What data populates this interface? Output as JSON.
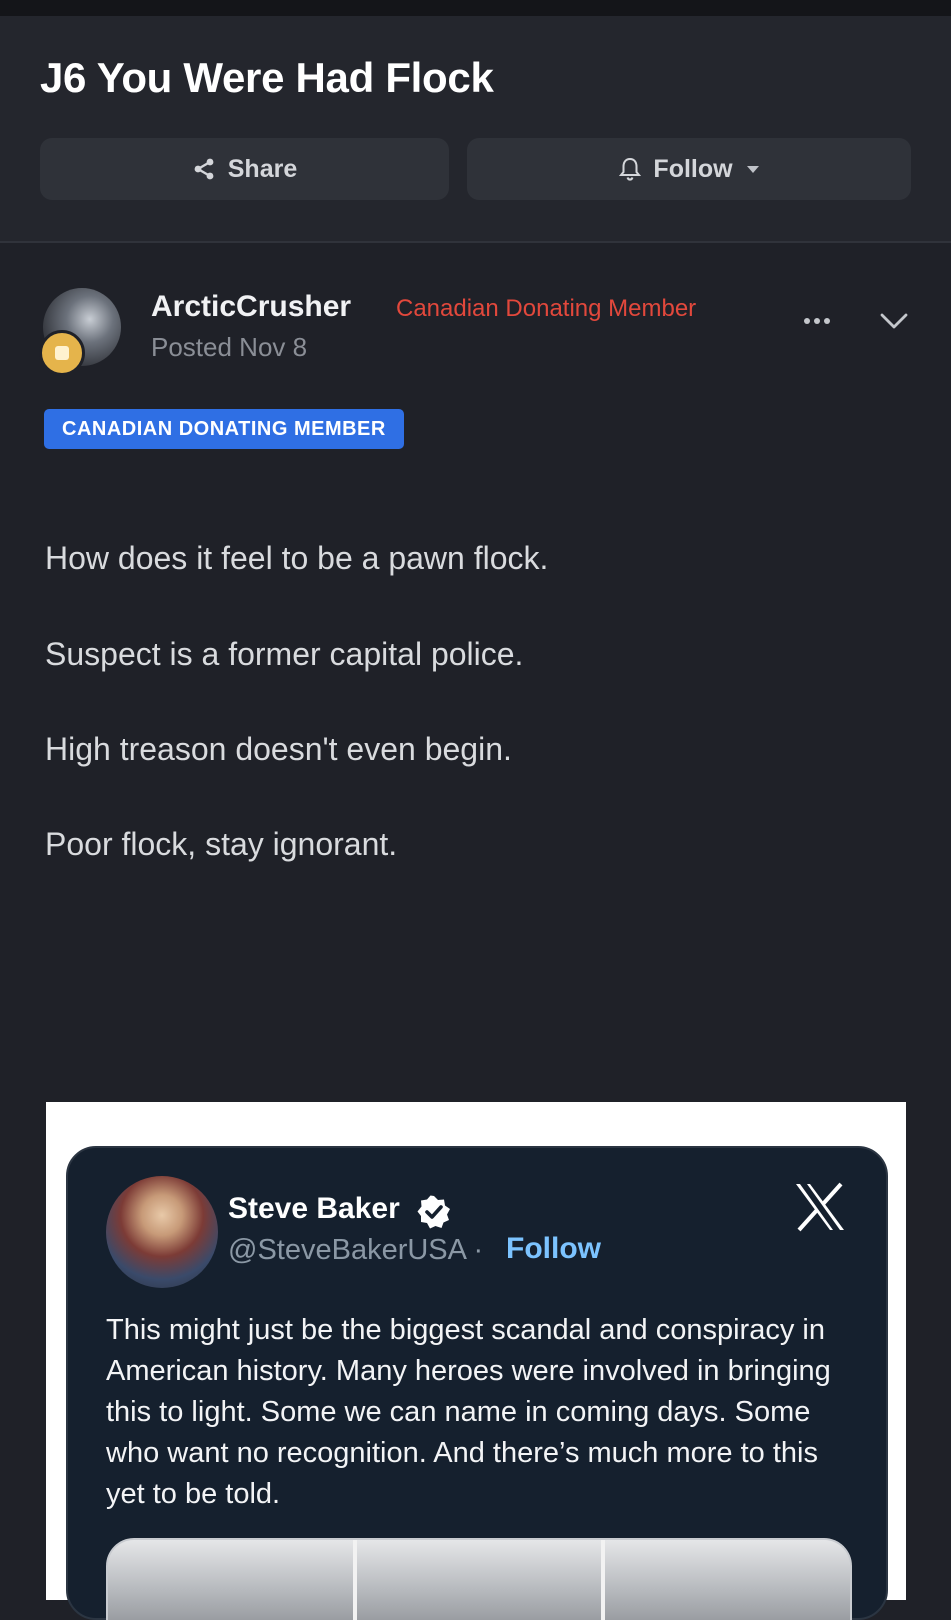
{
  "thread": {
    "title": "J6 You Were Had Flock",
    "share_label": "Share",
    "follow_label": "Follow"
  },
  "post": {
    "author": "ArcticCrusher",
    "role": "Canadian Donating Member",
    "date": "Posted Nov 8",
    "badge": "CANADIAN DONATING MEMBER",
    "lines": [
      "How does it feel to be a pawn flock.",
      "Suspect is a former capital police.",
      "High treason doesn't even begin.",
      "Poor flock, stay ignorant."
    ]
  },
  "embed": {
    "name": "Steve Baker",
    "handle": "@SteveBakerUSA · ",
    "follow_label": "Follow",
    "text": "This might just be the biggest scandal and conspiracy in American history. Many heroes were involved in bringing this to light. Some we can name in coming days. Some who want no recognition. And there’s much more to this yet to be told."
  },
  "colors": {
    "background": "#1f2128",
    "header": "#24262d",
    "role_red": "#e2483c",
    "badge_blue": "#2f6fe4",
    "tweet_bg": "#15202e",
    "tweet_link": "#7cc3ff"
  },
  "icons": [
    "share-icon",
    "bell-icon",
    "more-icon",
    "chevron-down-icon",
    "verified-icon",
    "x-logo-icon"
  ]
}
